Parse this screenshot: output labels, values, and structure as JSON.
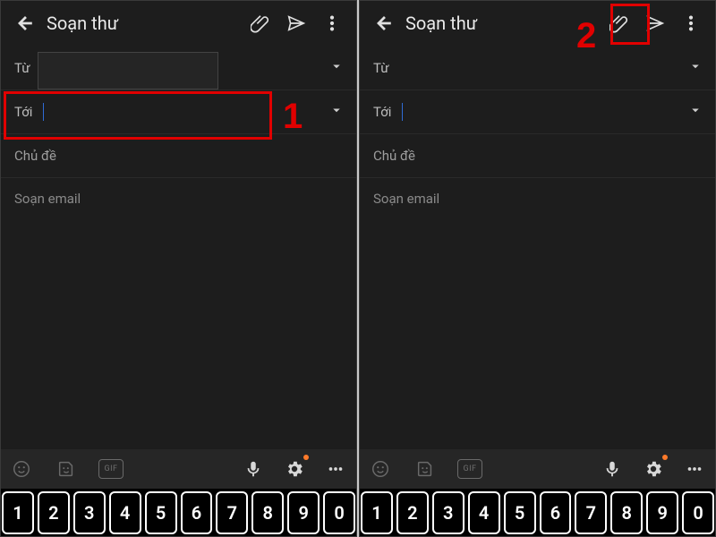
{
  "header": {
    "title": "Soạn thư"
  },
  "fields": {
    "from_label": "Từ",
    "to_label": "Tới",
    "subject_placeholder": "Chủ đề",
    "body_placeholder": "Soạn email"
  },
  "keyboard": {
    "gif_label": "GIF",
    "keys": [
      "1",
      "2",
      "3",
      "4",
      "5",
      "6",
      "7",
      "8",
      "9",
      "0"
    ]
  },
  "annotations": {
    "step1": "1",
    "step2": "2"
  },
  "icons": {
    "back": "back-arrow-icon",
    "attach": "attachment-icon",
    "send": "send-icon",
    "more": "more-vert-icon",
    "chevron": "chevron-down-icon",
    "emoji": "emoji-icon",
    "sticker": "sticker-icon",
    "mic": "mic-icon",
    "settings": "settings-gear-icon",
    "overflow": "ellipsis-icon"
  }
}
